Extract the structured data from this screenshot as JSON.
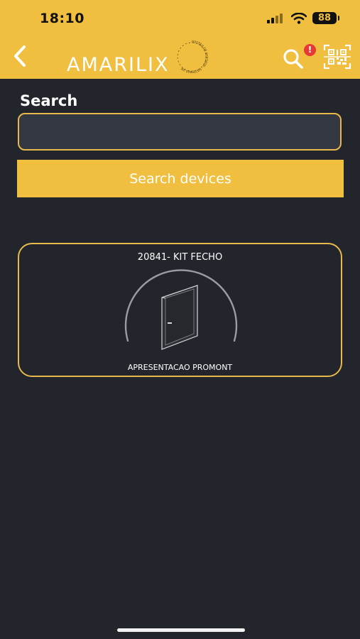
{
  "status_bar": {
    "time": "18:10",
    "battery": "88"
  },
  "header": {
    "logo_text": "AMARILIX",
    "logo_ring_text": "GESTÃO DE ACESSOS · SISTEMAS DE",
    "alert_badge": "!",
    "icons": {
      "back": "chevron-left-icon",
      "search": "search-icon",
      "qr": "qr-code-icon"
    }
  },
  "search": {
    "label": "Search",
    "value": "",
    "placeholder": "",
    "button_label": "Search devices"
  },
  "devices": [
    {
      "name": "20841- KIT FECHO",
      "location": "APRESENTACAO PROMONT",
      "icon": "door-icon"
    }
  ],
  "colors": {
    "accent": "#f0bf3f",
    "background": "#22252b",
    "input_background": "#333842",
    "alert": "#e53935"
  }
}
